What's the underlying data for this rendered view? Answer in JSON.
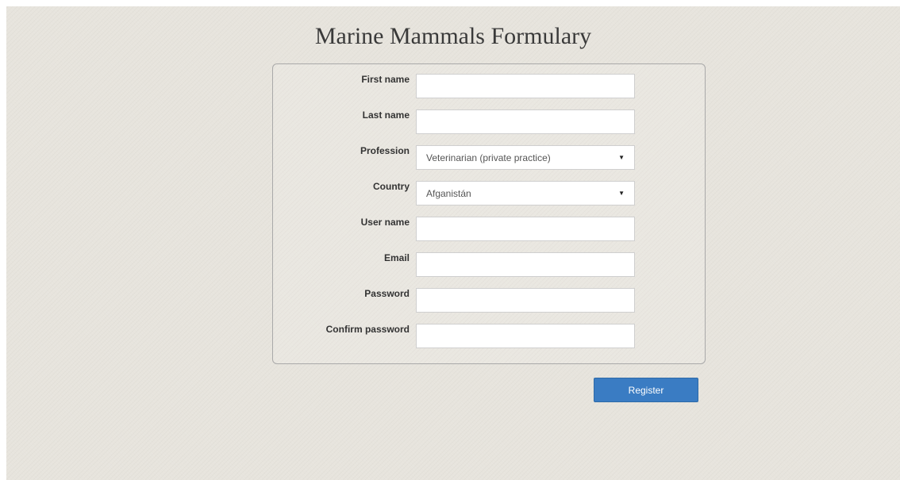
{
  "page": {
    "title": "Marine Mammals Formulary"
  },
  "form": {
    "first_name": {
      "label": "First name",
      "value": ""
    },
    "last_name": {
      "label": "Last name",
      "value": ""
    },
    "profession": {
      "label": "Profession",
      "selected": "Veterinarian (private practice)"
    },
    "country": {
      "label": "Country",
      "selected": "Afganistán"
    },
    "user_name": {
      "label": "User name",
      "value": ""
    },
    "email": {
      "label": "Email",
      "value": ""
    },
    "password": {
      "label": "Password",
      "value": ""
    },
    "confirm_password": {
      "label": "Confirm password",
      "value": ""
    },
    "register_label": "Register"
  },
  "icons": {
    "select_caret": "caret-down-icon"
  },
  "colors": {
    "background": "#e7e4dd",
    "button": "#3a7cc3",
    "panel_border": "#a9a9a9"
  }
}
